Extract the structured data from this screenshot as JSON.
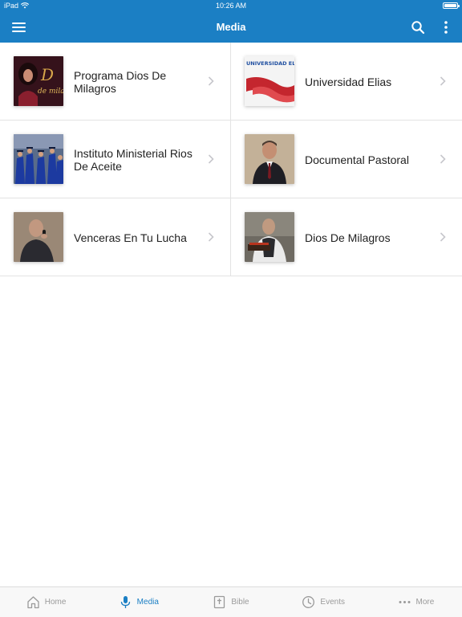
{
  "status_bar": {
    "device": "iPad",
    "time": "10:26 AM"
  },
  "header": {
    "title": "Media"
  },
  "colors": {
    "brand": "#1b7fc4",
    "divider": "#e3e3e3",
    "tab_inactive": "#9a9a9a"
  },
  "media_items": [
    {
      "label": "Programa Dios De Milagros",
      "thumb": "programa-dios-de-milagros-thumbnail"
    },
    {
      "label": "Universidad Elias",
      "thumb": "universidad-elias-logo-thumbnail",
      "logo_text": "UNIVERSIDAD ELIAS"
    },
    {
      "label": "Instituto Ministerial Rios De Aceite",
      "thumb": "graduation-ceremony-thumbnail"
    },
    {
      "label": "Documental Pastoral",
      "thumb": "pastor-portrait-thumbnail"
    },
    {
      "label": "Venceras En Tu Lucha",
      "thumb": "preacher-with-microphone-thumbnail"
    },
    {
      "label": "Dios De Milagros",
      "thumb": "preacher-at-pulpit-thumbnail"
    }
  ],
  "tabs": [
    {
      "label": "Home",
      "icon": "home-icon",
      "active": false
    },
    {
      "label": "Media",
      "icon": "microphone-icon",
      "active": true
    },
    {
      "label": "Bible",
      "icon": "bible-icon",
      "active": false
    },
    {
      "label": "Events",
      "icon": "clock-icon",
      "active": false
    },
    {
      "label": "More",
      "icon": "ellipsis-icon",
      "active": false
    }
  ]
}
